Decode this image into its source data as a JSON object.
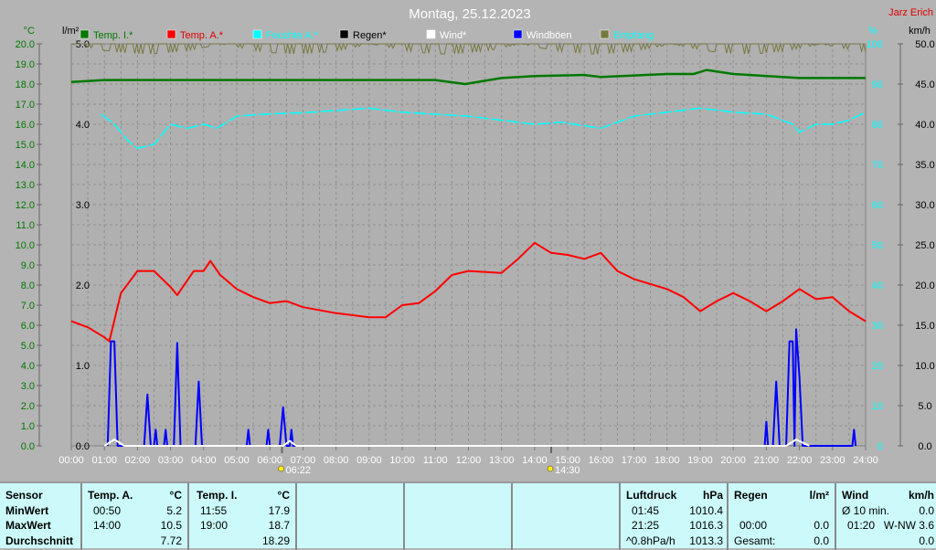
{
  "title": "Montag, 25.12.2023",
  "author": "Jarz Erich",
  "colors": {
    "temp_i": "#007800",
    "temp_a": "#ff0000",
    "feuchte": "#00ffff",
    "regen": "#000000",
    "wind": "#ffffff",
    "windboeen": "#0000ff",
    "empfang": "#787840"
  },
  "chart_data": {
    "type": "line",
    "title": "Montag, 25.12.2023",
    "legend_position": "top",
    "legend": [
      "Temp. I.*",
      "Temp. A.*",
      "Feuchte A.*",
      "Regen*",
      "Wind*",
      "Windböen",
      "Empfang"
    ],
    "axes": {
      "temp": {
        "label": "°C",
        "ylim": [
          0,
          20
        ],
        "ticks": [
          "20.0",
          "19.0",
          "18.0",
          "17.0",
          "16.0",
          "15.0",
          "14.0",
          "13.0",
          "12.0",
          "11.0",
          "10.0",
          "9.0",
          "8.0",
          "7.0",
          "6.0",
          "5.0",
          "4.0",
          "3.0",
          "2.0",
          "1.0",
          "0.0"
        ]
      },
      "rain": {
        "label": "l/m²",
        "ylim": [
          0,
          5
        ],
        "ticks": [
          "5.0",
          "4.0",
          "3.0",
          "2.0",
          "1.0",
          "0.0"
        ]
      },
      "humidity": {
        "label": "%",
        "ylim": [
          0,
          100
        ],
        "ticks": [
          "100",
          "90",
          "80",
          "70",
          "60",
          "50",
          "40",
          "30",
          "20",
          "10",
          "0"
        ]
      },
      "wind": {
        "label": "km/h",
        "ylim": [
          0,
          50
        ],
        "ticks": [
          "50.0",
          "45.0",
          "40.0",
          "35.0",
          "30.0",
          "25.0",
          "20.0",
          "15.0",
          "10.0",
          "5.0",
          "0.0"
        ]
      }
    },
    "x_ticks": [
      "00:00",
      "01:00",
      "02:00",
      "03:00",
      "04:00",
      "05:00",
      "06:00",
      "07:00",
      "08:00",
      "09:00",
      "10:00",
      "11:00",
      "12:00",
      "13:00",
      "14:00",
      "15:00",
      "16:00",
      "17:00",
      "18:00",
      "19:00",
      "20:00",
      "21:00",
      "22:00",
      "23:00",
      "24:00"
    ],
    "sunrise": "06:22",
    "sunset": "14:30",
    "grid": true,
    "series": [
      {
        "name": "Temp. A.*",
        "axis": "temp",
        "points": [
          [
            0,
            6.2
          ],
          [
            0.5,
            5.9
          ],
          [
            1,
            5.4
          ],
          [
            1.15,
            5.2
          ],
          [
            1.5,
            7.6
          ],
          [
            2,
            8.7
          ],
          [
            2.5,
            8.7
          ],
          [
            3,
            7.9
          ],
          [
            3.2,
            7.5
          ],
          [
            3.7,
            8.7
          ],
          [
            4,
            8.7
          ],
          [
            4.2,
            9.2
          ],
          [
            4.5,
            8.5
          ],
          [
            5,
            7.8
          ],
          [
            5.5,
            7.4
          ],
          [
            6,
            7.1
          ],
          [
            6.5,
            7.2
          ],
          [
            7,
            6.9
          ],
          [
            8,
            6.6
          ],
          [
            9,
            6.4
          ],
          [
            9.5,
            6.4
          ],
          [
            10,
            7.0
          ],
          [
            10.5,
            7.1
          ],
          [
            11,
            7.7
          ],
          [
            11.5,
            8.5
          ],
          [
            12,
            8.7
          ],
          [
            13,
            8.6
          ],
          [
            13.5,
            9.3
          ],
          [
            14,
            10.1
          ],
          [
            14.5,
            9.6
          ],
          [
            15,
            9.5
          ],
          [
            15.5,
            9.3
          ],
          [
            16,
            9.6
          ],
          [
            16.5,
            8.7
          ],
          [
            17,
            8.3
          ],
          [
            18,
            7.8
          ],
          [
            18.5,
            7.4
          ],
          [
            19,
            6.7
          ],
          [
            19.5,
            7.2
          ],
          [
            20,
            7.6
          ],
          [
            20.5,
            7.2
          ],
          [
            21,
            6.7
          ],
          [
            21.5,
            7.2
          ],
          [
            22,
            7.8
          ],
          [
            22.5,
            7.3
          ],
          [
            23,
            7.4
          ],
          [
            23.5,
            6.7
          ],
          [
            24,
            6.2
          ]
        ]
      },
      {
        "name": "Temp. I.*",
        "axis": "temp",
        "points": [
          [
            0,
            18.1
          ],
          [
            1,
            18.2
          ],
          [
            11,
            18.2
          ],
          [
            11.9,
            18.0
          ],
          [
            13,
            18.3
          ],
          [
            14,
            18.4
          ],
          [
            15.5,
            18.45
          ],
          [
            16,
            18.35
          ],
          [
            18,
            18.5
          ],
          [
            18.8,
            18.5
          ],
          [
            19.2,
            18.7
          ],
          [
            20,
            18.5
          ],
          [
            22,
            18.3
          ],
          [
            23,
            18.3
          ],
          [
            24,
            18.3
          ]
        ]
      },
      {
        "name": "Feuchte A.*",
        "axis": "humidity",
        "points": [
          [
            0.9,
            82.5
          ],
          [
            1.3,
            80
          ],
          [
            1.7,
            76
          ],
          [
            2,
            74
          ],
          [
            2.5,
            75
          ],
          [
            3,
            80
          ],
          [
            3.5,
            79
          ],
          [
            4,
            80
          ],
          [
            4.4,
            79
          ],
          [
            5,
            82
          ],
          [
            5.8,
            82.5
          ],
          [
            7.3,
            83
          ],
          [
            9,
            84
          ],
          [
            10,
            83
          ],
          [
            12,
            82
          ],
          [
            13,
            81
          ],
          [
            14,
            80
          ],
          [
            14.8,
            80.5
          ],
          [
            16,
            79
          ],
          [
            17,
            82
          ],
          [
            18,
            83
          ],
          [
            19,
            84
          ],
          [
            20,
            83
          ],
          [
            21,
            82.5
          ],
          [
            21.8,
            80
          ],
          [
            22,
            78
          ],
          [
            22.5,
            80
          ],
          [
            23,
            80
          ],
          [
            23.5,
            81
          ],
          [
            24,
            83
          ]
        ]
      },
      {
        "name": "Windböen",
        "axis": "wind",
        "points": [
          [
            1.1,
            0
          ],
          [
            1.2,
            13
          ],
          [
            1.3,
            13
          ],
          [
            1.4,
            0
          ],
          [
            2.2,
            0
          ],
          [
            2.3,
            6.4
          ],
          [
            2.4,
            0
          ],
          [
            2.5,
            0
          ],
          [
            2.55,
            2
          ],
          [
            2.6,
            0
          ],
          [
            2.8,
            0
          ],
          [
            2.85,
            2
          ],
          [
            2.9,
            0
          ],
          [
            3.1,
            0
          ],
          [
            3.2,
            12.8
          ],
          [
            3.3,
            0
          ],
          [
            3.75,
            0
          ],
          [
            3.85,
            8
          ],
          [
            3.95,
            0
          ],
          [
            5.3,
            0
          ],
          [
            5.35,
            2
          ],
          [
            5.4,
            0
          ],
          [
            5.9,
            0
          ],
          [
            5.95,
            2
          ],
          [
            6.0,
            0
          ],
          [
            6.3,
            0
          ],
          [
            6.4,
            4.8
          ],
          [
            6.5,
            0
          ],
          [
            6.6,
            0
          ],
          [
            6.65,
            2
          ],
          [
            6.7,
            0
          ],
          [
            20.95,
            0
          ],
          [
            21.0,
            3
          ],
          [
            21.05,
            0
          ],
          [
            21.2,
            0
          ],
          [
            21.3,
            8
          ],
          [
            21.4,
            0
          ],
          [
            21.6,
            0
          ],
          [
            21.7,
            13
          ],
          [
            21.8,
            13
          ],
          [
            21.85,
            0
          ],
          [
            21.9,
            14.5
          ],
          [
            22.0,
            8.6
          ],
          [
            22.1,
            0
          ],
          [
            23.6,
            0
          ],
          [
            23.65,
            2
          ],
          [
            23.7,
            0
          ]
        ]
      },
      {
        "name": "Wind*",
        "axis": "wind",
        "points": [
          [
            1,
            0
          ],
          [
            1.3,
            0.8
          ],
          [
            1.6,
            0
          ],
          [
            6.4,
            0
          ],
          [
            6.6,
            0.6
          ],
          [
            6.8,
            0
          ],
          [
            21.6,
            0
          ],
          [
            21.9,
            0.8
          ],
          [
            22.3,
            0
          ]
        ]
      },
      {
        "name": "Empfang",
        "axis": "humidity",
        "points": "noise-near-100"
      }
    ]
  },
  "table": {
    "sensor": {
      "header": "Sensor",
      "rows": [
        "MinWert",
        "MaxWert",
        "Durchschnitt"
      ]
    },
    "temp_a": {
      "header": "Temp. A.",
      "unit": "°C",
      "min_time": "00:50",
      "min": "5.2",
      "max_time": "14:00",
      "max": "10.5",
      "avg": "7.72"
    },
    "temp_i": {
      "header": "Temp. I.",
      "unit": "°C",
      "min_time": "11:55",
      "min": "17.9",
      "max_time": "19:00",
      "max": "18.7",
      "avg": "18.29"
    },
    "luftdruck": {
      "header": "Luftdruck",
      "unit": "hPa",
      "min_time": "01:45",
      "min": "1010.4",
      "max_time": "21:25",
      "max": "1016.3",
      "trend": "^0.8hPa/h",
      "avg": "1013.3"
    },
    "regen": {
      "header": "Regen",
      "unit": "l/m²",
      "time": "00:00",
      "value": "0.0",
      "total_label": "Gesamt:",
      "total": "0.0"
    },
    "wind": {
      "header": "Wind",
      "unit": "km/h",
      "avg_label": "Ø 10 min.",
      "avg": "0.0",
      "max_time": "01:20",
      "max": "W-NW 3.6",
      "last": "0.0"
    }
  }
}
